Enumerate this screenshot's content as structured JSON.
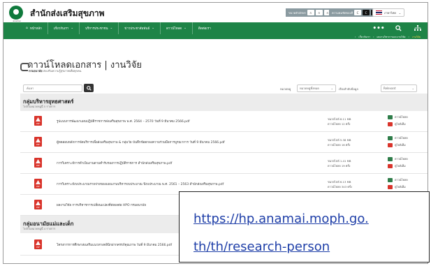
{
  "header": {
    "logo_caption": "anamai",
    "site_title": "สำนักส่งเสริมสุขภาพ",
    "font_size_label": "ขนาดตัวอักษร",
    "font_size_options": [
      "ก",
      "ก",
      "ก"
    ],
    "contrast_label": "ความคมชัดของสี",
    "contrast_options": [
      "C",
      "C",
      "C"
    ],
    "language": "ภาษาไทย"
  },
  "nav": {
    "items": [
      "หน้าหลัก",
      "เกี่ยวกับเรา",
      "บริการประชาชน",
      "ข่าวประชาสัมพันธ์",
      "ดาวน์โหลด",
      "ติดต่อเรา"
    ],
    "tools": [
      "•••",
      "🔍",
      "⋔"
    ]
  },
  "breadcrumb": [
    "เกี่ยวกับเรา",
    "ผลงานวิชาการและงานวิจัย",
    "งานวิจัย"
  ],
  "page": {
    "title": "ดาวน์โหลดเอกสาร | งานวิจัย",
    "subtitle_bold": "กรมอนามัย",
    "subtitle": "ส่งเสริมความรู้สุขภาพเพื่อทุกคน"
  },
  "filters": {
    "search_placeholder": "ค้นหา",
    "category_label": "หมวดหมู่",
    "category_value": "หมวดหมู่ทั้งหมด",
    "sort_label": "เรียงลำดับข้อมูล",
    "sort_value": "Relevant"
  },
  "sections": [
    {
      "title": "กลุ่มบริหารยุทธศาสตร์",
      "count": "ไฟล์ในหมวดหมู่นี้ 5 รายการ",
      "docs": [
        {
          "title": "รูปแบบการพัฒนาแผนปฏิบัติราชการส่งเสริมสุขภาพ พ.ศ. 2564 – 2570 วันที่ 9 มีนาคม 2566.pdf",
          "size": "ขนาดไฟล์ 6.11 MB",
          "downloads": "ดาวน์โหลด 12 ครั้ง"
        },
        {
          "title": "ผู้ทดสอบหลักการจัดบริการเพื่อส่งเสริมสุขภาพ & กลุ่มวัย บันทึกข้อตกลงความร่วมมือการบูรณาการ วันที่ 9 มีนาคม 2566.pdf",
          "size": "ขนาดไฟล์ 5.38 MB",
          "downloads": "ดาวน์โหลด 16 ครั้ง"
        },
        {
          "title": "การวิเคราะห์การดำเนินงานตามคำรับรองการปฏิบัติราชการ สำนักส่งเสริมสุขภาพ.pdf",
          "size": "ขนาดไฟล์ 1.41 MB",
          "downloads": "ดาวน์โหลด 19 ครั้ง"
        },
        {
          "title": "การวิเคราะห์งบประมาณรายจ่ายของแผนงานบริหารงบประมาณ ปีงบประมาณ พ.ศ. 2561 – 2563 สำนักส่งเสริมสุขภาพ.pdf",
          "size": "ขนาดไฟล์ 6.13 MB",
          "downloads": "ดาวน์โหลด 343 ครั้ง"
        },
        {
          "title": "ผลงานวิจัย การบริหารการเปลี่ยนแปลงที่ส่งผลต่อ HPO กรมอนามัย",
          "size": "",
          "downloads": ""
        }
      ]
    },
    {
      "title": "กลุ่มอนามัยแม่และเด็ก",
      "count": "ไฟล์ในหมวดหมู่นี้ 4 รายการ",
      "docs": [
        {
          "title": "โครงการการศึกษาส่งเสริมแนวทางคลินิกฝากครรภ์คุณภาพ วันที่ 9 มีนาคม 2566.pdf",
          "size": "",
          "downloads": ""
        }
      ]
    }
  ],
  "actions": {
    "download": "ดาวน์โหลด",
    "preview": "ดูไฟล์เต็ม"
  },
  "overlay": {
    "url_line1": "https://hp.anamai.moph.go.",
    "url_line2": "th/th/research-person"
  }
}
